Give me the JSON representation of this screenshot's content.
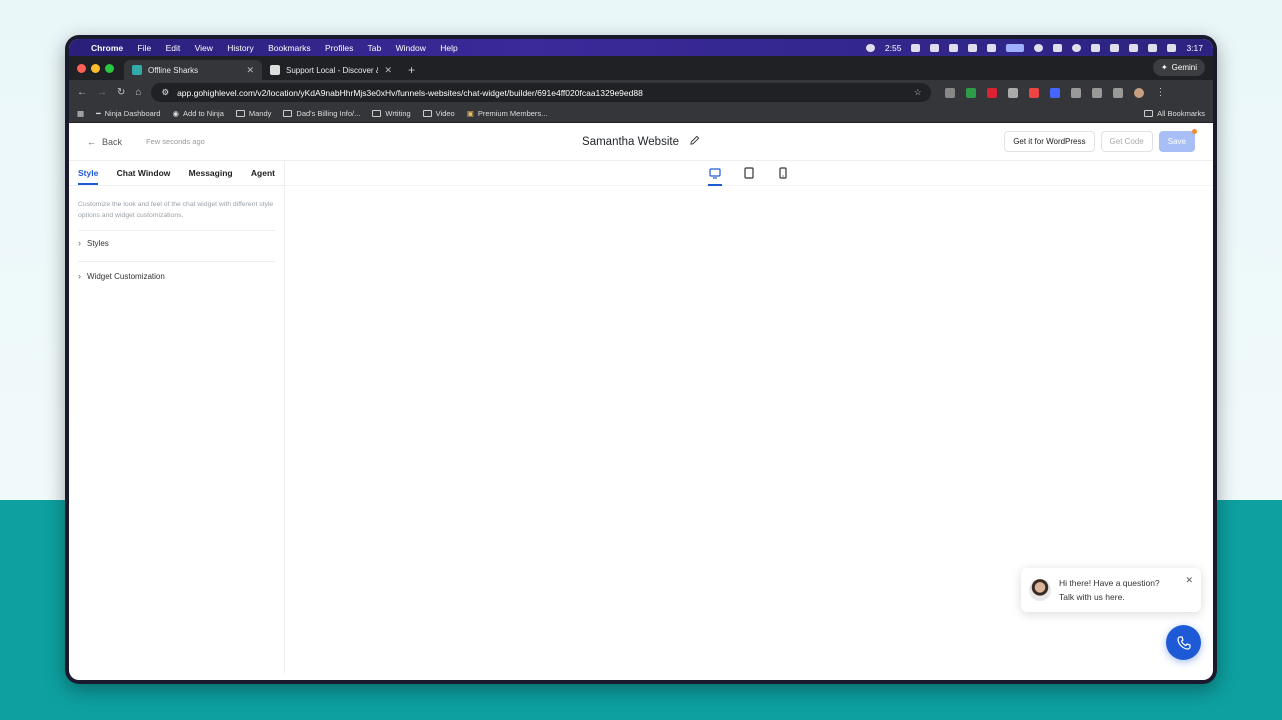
{
  "menubar": {
    "app": "Chrome",
    "menus": [
      "File",
      "Edit",
      "View",
      "History",
      "Bookmarks",
      "Profiles",
      "Tab",
      "Window",
      "Help"
    ],
    "timer": "2:55",
    "clock": "3:17"
  },
  "browser": {
    "tabs": [
      {
        "title": "Offline Sharks",
        "active": true
      },
      {
        "title": "Support Local - Discover & S",
        "active": false
      }
    ],
    "gemini_label": "Gemini",
    "url": "app.gohighlevel.com/v2/location/yKdA9nabHhrMjs3e0xHv/funnels-websites/chat-widget/builder/691e4ff020fcaa1329e9ed88",
    "bookmarks": [
      "Ninja Dashboard",
      "Add to Ninja",
      "Mandy",
      "Dad's Billing Info/...",
      "Wrtiting",
      "Video",
      "Premium Members..."
    ],
    "all_bookmarks": "All Bookmarks"
  },
  "header": {
    "back_label": "Back",
    "saved_status": "Few seconds ago",
    "title": "Samantha Website",
    "wordpress_button": "Get it for WordPress",
    "get_code_button": "Get Code",
    "save_button": "Save"
  },
  "sidebar": {
    "tabs": [
      "Style",
      "Chat Window",
      "Messaging",
      "Agent"
    ],
    "description": "Customize the look and feel of the chat widget with different style options and widget customizations.",
    "sections": [
      "Styles",
      "Widget Customization"
    ]
  },
  "widget": {
    "greeting_line1": "Hi there! Have a question?",
    "greeting_line2": "Talk with us here."
  },
  "colors": {
    "accent": "#1f5ad6",
    "teal_background": "#0ea0a0"
  }
}
